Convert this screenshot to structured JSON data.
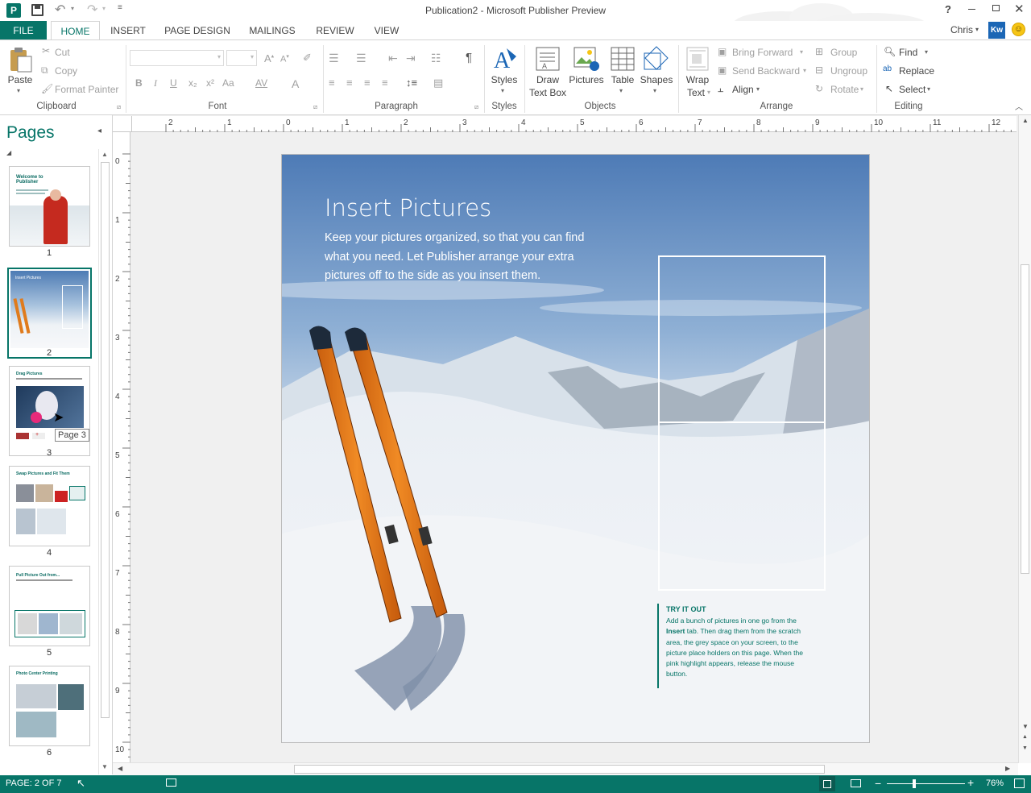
{
  "window": {
    "title": "Publication2 - Microsoft Publisher Preview",
    "user": "Chris",
    "user_initials": "Kw"
  },
  "tabs": [
    "FILE",
    "HOME",
    "INSERT",
    "PAGE DESIGN",
    "MAILINGS",
    "REVIEW",
    "VIEW"
  ],
  "active_tab": "HOME",
  "ribbon": {
    "clipboard": {
      "paste": "Paste",
      "cut": "Cut",
      "copy": "Copy",
      "format_painter": "Format Painter",
      "label": "Clipboard"
    },
    "font": {
      "label": "Font",
      "bold": "B",
      "italic": "I",
      "underline": "U",
      "subscript": "x₂",
      "superscript": "x²",
      "change_case": "Aa",
      "spacing": "AV",
      "font_color": "A"
    },
    "paragraph": {
      "label": "Paragraph",
      "pilcrow": "¶"
    },
    "styles": {
      "button": "Styles",
      "label": "Styles"
    },
    "objects": {
      "draw_text_box": [
        "Draw",
        "Text Box"
      ],
      "pictures": "Pictures",
      "table": "Table",
      "shapes": "Shapes",
      "label": "Objects"
    },
    "arrange": {
      "wrap_text": [
        "Wrap",
        "Text"
      ],
      "bring_forward": "Bring Forward",
      "send_backward": "Send Backward",
      "align": "Align",
      "group": "Group",
      "ungroup": "Ungroup",
      "rotate": "Rotate",
      "label": "Arrange"
    },
    "editing": {
      "find": "Find",
      "replace": "Replace",
      "select": "Select",
      "label": "Editing"
    }
  },
  "pages_pane": {
    "title": "Pages",
    "thumbnails": [
      "1",
      "2",
      "3",
      "4",
      "5",
      "6"
    ],
    "selected": "2",
    "tooltip": "Page 3"
  },
  "rulers": {
    "horizontal": [
      "2",
      "1",
      "0",
      "1",
      "2",
      "3",
      "4",
      "5",
      "6",
      "7",
      "8",
      "9",
      "10",
      "11",
      "12"
    ],
    "vertical": [
      "0",
      "1",
      "2",
      "3",
      "4",
      "5",
      "6",
      "7",
      "8",
      "9",
      "10"
    ]
  },
  "page_content": {
    "heading": "Insert Pictures",
    "body": "Keep your pictures organized, so that you can find what you need. Let Publisher arrange your extra pictures off to the side as you insert them.",
    "try_it_title": "TRY IT OUT",
    "try_it_pre": "Add a bunch of pictures in one go from the ",
    "try_it_bold": "Insert",
    "try_it_post": " tab. Then drag them from the scratch area, the grey space  on your screen, to the picture place holders on this page. When the pink highlight appears, release the mouse button."
  },
  "status": {
    "page": "PAGE: 2 OF 7",
    "zoom": "76%"
  },
  "colors": {
    "accent": "#077568",
    "status_bg": "#077568"
  }
}
